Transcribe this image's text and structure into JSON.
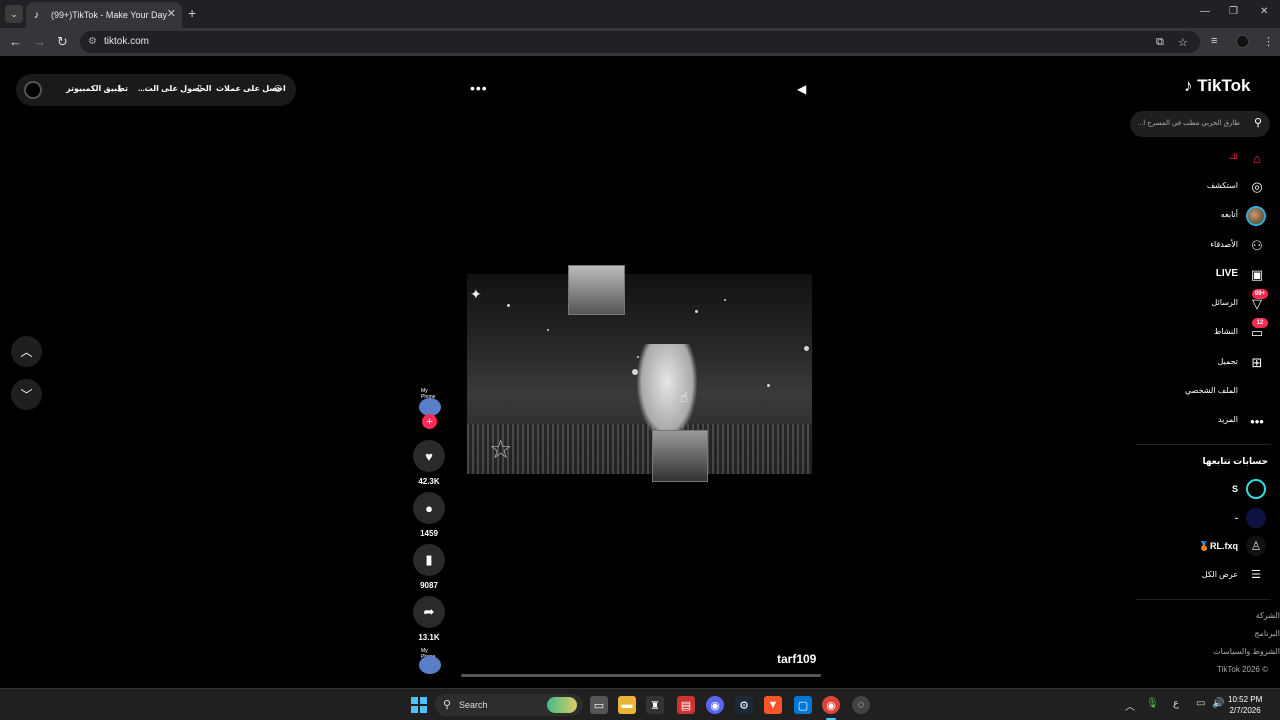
{
  "browser": {
    "tab_title": "(99+)TikTok - Make Your Day",
    "url": "tiktok.com",
    "icons": [
      "tab-list-icon",
      "tiktok-favicon",
      "close-icon",
      "new-tab-icon",
      "minimize-icon",
      "maximize-icon",
      "window-close-icon",
      "back-icon",
      "forward-icon",
      "reload-icon",
      "site-info-icon",
      "install-app-icon",
      "bookmark-star-icon",
      "reading-list-icon",
      "profile-icon",
      "menu-icon"
    ]
  },
  "top_bar": {
    "get_coins": "احصل على عملات",
    "get_app": "الحصول على الت...",
    "pc_app": "تطبيق الكمبيوتر"
  },
  "sidebar": {
    "logo": "TikTok",
    "search_placeholder": "طارق الحربي مطب في المسرح ا...",
    "nav": [
      {
        "label": "لك",
        "icon": "home-icon",
        "active": true
      },
      {
        "label": "استكشف",
        "icon": "compass-icon"
      },
      {
        "label": "أتابعه",
        "icon": "following-avatar-icon"
      },
      {
        "label": "الأصدقاء",
        "icon": "friends-icon"
      },
      {
        "label": "LIVE",
        "icon": "live-icon"
      },
      {
        "label": "الرسائل",
        "icon": "messages-icon",
        "badge": "99+"
      },
      {
        "label": "النشاط",
        "icon": "activity-icon",
        "badge": "12"
      },
      {
        "label": "تحميل",
        "icon": "upload-icon"
      },
      {
        "label": "الملف الشخصي",
        "icon": "profile-icon"
      },
      {
        "label": "المزيد",
        "icon": "more-icon"
      }
    ],
    "following_title": "حسابات تتابعها",
    "following": [
      {
        "name": "S"
      },
      {
        "name": "-"
      },
      {
        "name": "🥉RL.fxq"
      }
    ],
    "see_all": "عرض الكل",
    "footer": [
      "الشركة",
      "البرنامج",
      "الشروط والسياسات",
      "© TikTok 2026"
    ]
  },
  "video": {
    "author": "tarf109",
    "likes": "42.3K",
    "comments": "1459",
    "saves": "9087",
    "shares": "13.1K",
    "avatar_text": "My Phone",
    "music_text": "My Phone"
  },
  "taskbar": {
    "search_label": "Search",
    "lang": "ع",
    "time": "10:52 PM",
    "date": "2/7/2026"
  }
}
